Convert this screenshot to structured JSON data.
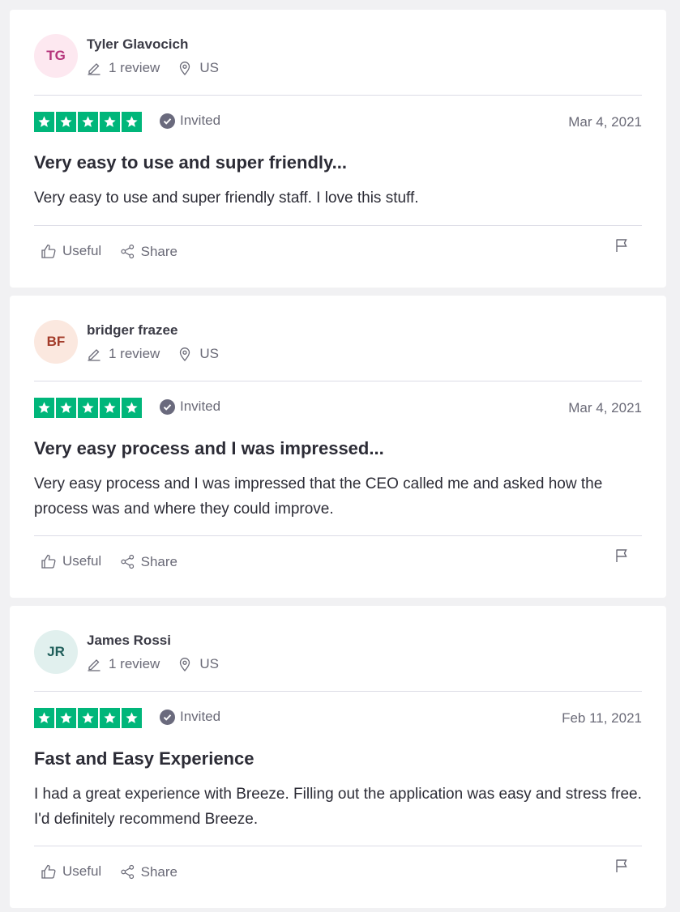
{
  "colors": {
    "star_green": "#00b67a",
    "text_dark": "#2c2c36",
    "text_muted": "#6a6a77",
    "divider": "#dcdce6"
  },
  "icons": {
    "review_count": "pencil-icon",
    "location": "map-pin-icon",
    "invited": "check-circle-icon",
    "useful": "thumbs-up-icon",
    "share": "share-icon",
    "report": "flag-icon",
    "star": "star-icon"
  },
  "reviews": [
    {
      "initials": "TG",
      "avatar_bg": "#fde8f0",
      "avatar_fg": "#b5347b",
      "name": "Tyler Glavocich",
      "review_count": "1 review",
      "country": "US",
      "rating": 5,
      "invited_label": "Invited",
      "date": "Mar 4, 2021",
      "title": "Very easy to use and super friendly...",
      "body": "Very easy to use and super friendly staff. I love this stuff.",
      "useful_label": "Useful",
      "share_label": "Share"
    },
    {
      "initials": "BF",
      "avatar_bg": "#fbe8df",
      "avatar_fg": "#a33c2a",
      "name": "bridger frazee",
      "review_count": "1 review",
      "country": "US",
      "rating": 5,
      "invited_label": "Invited",
      "date": "Mar 4, 2021",
      "title": "Very easy process and I was impressed...",
      "body": "Very easy process and I was impressed that the CEO called me and asked how the process was and where they could improve.",
      "useful_label": "Useful",
      "share_label": "Share"
    },
    {
      "initials": "JR",
      "avatar_bg": "#e1f0ee",
      "avatar_fg": "#1f5e5a",
      "name": "James Rossi",
      "review_count": "1 review",
      "country": "US",
      "rating": 5,
      "invited_label": "Invited",
      "date": "Feb 11, 2021",
      "title": "Fast and Easy Experience",
      "body": "I had a great experience with Breeze. Filling out the application was easy and stress free. I'd definitely recommend Breeze.",
      "useful_label": "Useful",
      "share_label": "Share"
    }
  ]
}
